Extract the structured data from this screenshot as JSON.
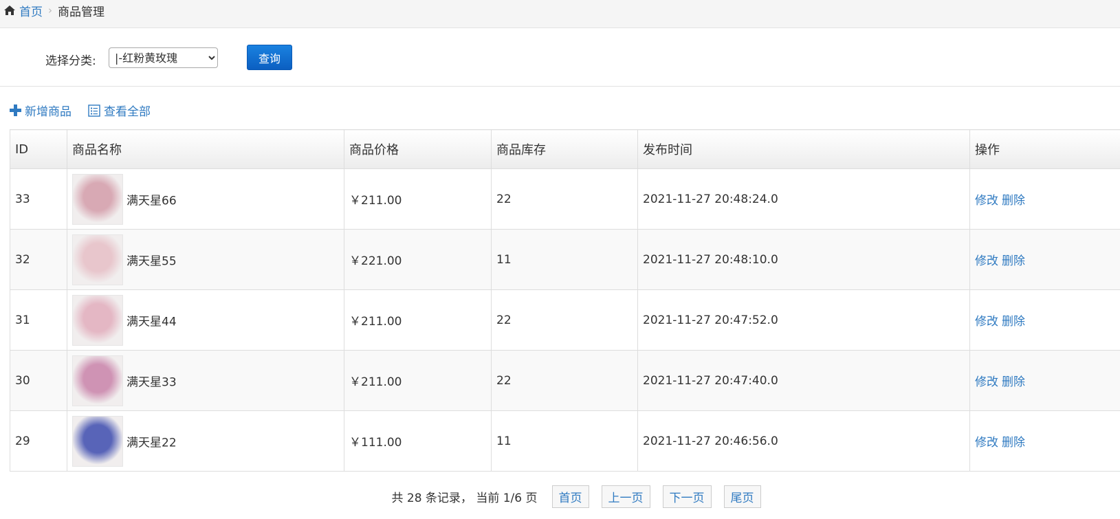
{
  "breadcrumb": {
    "home_label": "首页",
    "current_label": "商品管理"
  },
  "filter": {
    "label": "选择分类:",
    "selected_category": "|-红粉黄玫瑰",
    "query_label": "查询"
  },
  "actions": {
    "add_label": "新增商品",
    "view_all_label": "查看全部"
  },
  "table": {
    "headers": [
      "ID",
      "商品名称",
      "商品价格",
      "商品库存",
      "发布时间",
      "操作"
    ],
    "rows": [
      {
        "id": "33",
        "name": "满天星66",
        "price": "￥211.00",
        "stock": "22",
        "time": "2021-11-27 20:48:24.0",
        "edit": "修改",
        "delete": "删除",
        "thumb_color": "#d8a9b4"
      },
      {
        "id": "32",
        "name": "满天星55",
        "price": "￥221.00",
        "stock": "11",
        "time": "2021-11-27 20:48:10.0",
        "edit": "修改",
        "delete": "删除",
        "thumb_color": "#e8c6cc"
      },
      {
        "id": "31",
        "name": "满天星44",
        "price": "￥211.00",
        "stock": "22",
        "time": "2021-11-27 20:47:52.0",
        "edit": "修改",
        "delete": "删除",
        "thumb_color": "#e4b7c4"
      },
      {
        "id": "30",
        "name": "满天星33",
        "price": "￥211.00",
        "stock": "22",
        "time": "2021-11-27 20:47:40.0",
        "edit": "修改",
        "delete": "删除",
        "thumb_color": "#cf93b4"
      },
      {
        "id": "29",
        "name": "满天星22",
        "price": "￥111.00",
        "stock": "11",
        "time": "2021-11-27 20:46:56.0",
        "edit": "修改",
        "delete": "删除",
        "thumb_color": "#5864b8"
      }
    ]
  },
  "pagination": {
    "summary": "共 28 条记录， 当前 1/6 页",
    "first_label": "首页",
    "prev_label": "上一页",
    "next_label": "下一页",
    "last_label": "尾页"
  },
  "colors": {
    "link": "#2f7ac1",
    "primary_button": "#0b5fc1"
  }
}
